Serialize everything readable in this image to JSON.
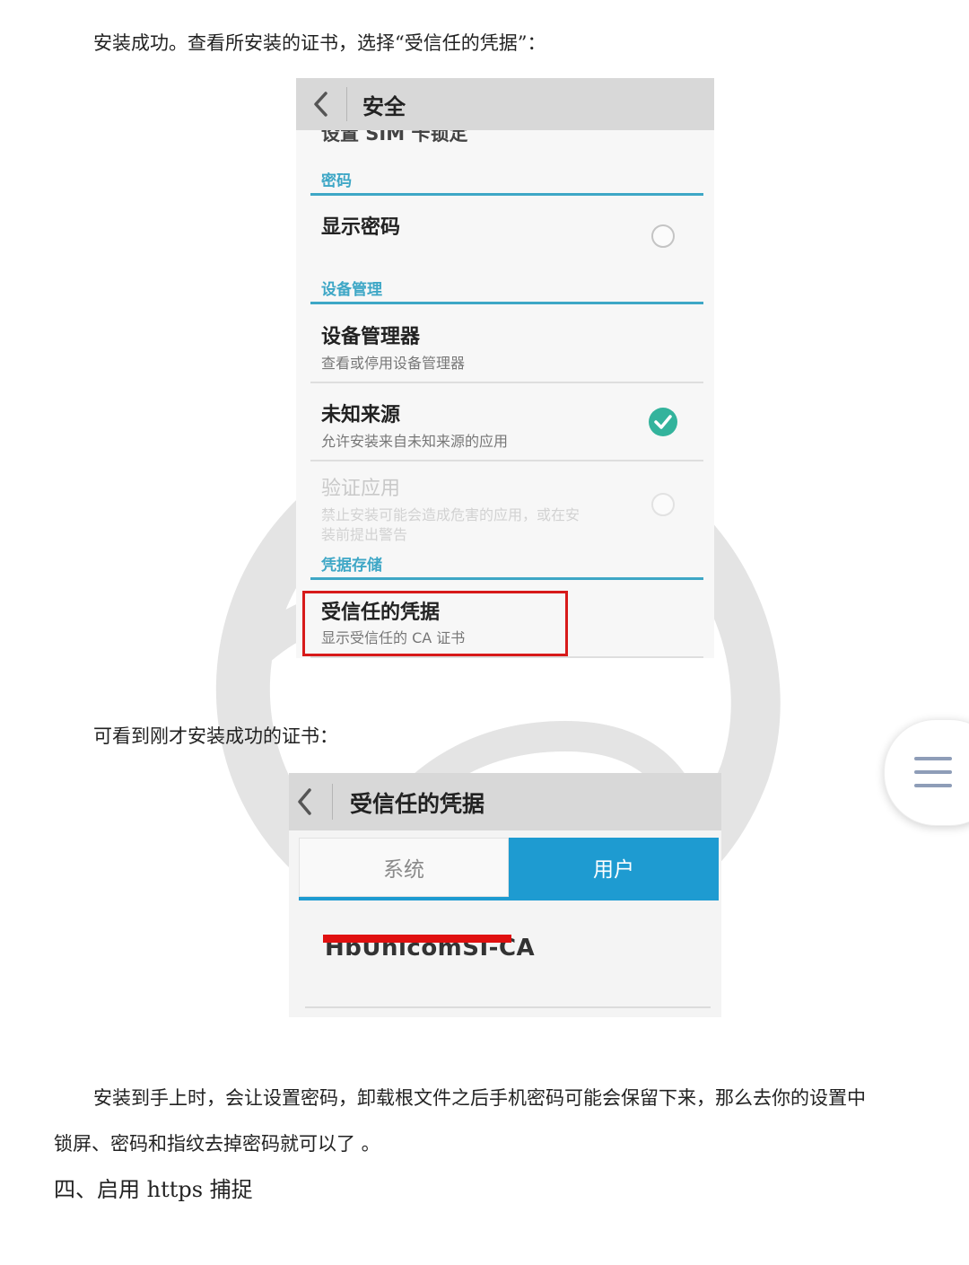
{
  "paragraphs": {
    "p1": "安装成功。查看所安装的证书，选择“受信任的凭据”：",
    "p2": "可看到刚才安装成功的证书：",
    "p3_line1": "安装到手上时，会让设置密码，卸载根文件之后手机密码可能会保留下来，那么去你的设置中",
    "p3_line2": "锁屏、密码和指纹去掉密码就可以了 。",
    "heading4": "四、启用 https 捕捉"
  },
  "screen1": {
    "title": "安全",
    "cut_item": "设置 SIM 卡锁定",
    "sections": {
      "password": "密码",
      "device_admin": "设备管理",
      "credential_storage": "凭据存储"
    },
    "items": {
      "show_password": {
        "title": "显示密码",
        "checked": false
      },
      "device_admins": {
        "title": "设备管理器",
        "subtitle": "查看或停用设备管理器"
      },
      "unknown_sources": {
        "title": "未知来源",
        "subtitle": "允许安装来自未知来源的应用",
        "checked": true
      },
      "verify_apps": {
        "title": "验证应用",
        "subtitle_line1": "禁止安装可能会造成危害的应用，或在安",
        "subtitle_line2": "装前提出警告",
        "checked": false,
        "enabled": false
      },
      "trusted_credentials": {
        "title": "受信任的凭据",
        "subtitle": "显示受信任的 CA 证书",
        "highlighted": true
      }
    },
    "highlight_color": "#d71a1a",
    "accent_color": "#3ea7c6"
  },
  "screen2": {
    "title": "受信任的凭据",
    "tabs": [
      {
        "label": "系统",
        "active": false
      },
      {
        "label": "用户",
        "active": true
      }
    ],
    "certificate": "HbUnicomSI-CA",
    "active_tab_color": "#1e9bd1"
  },
  "floating_button": {
    "icon": "menu-icon"
  }
}
